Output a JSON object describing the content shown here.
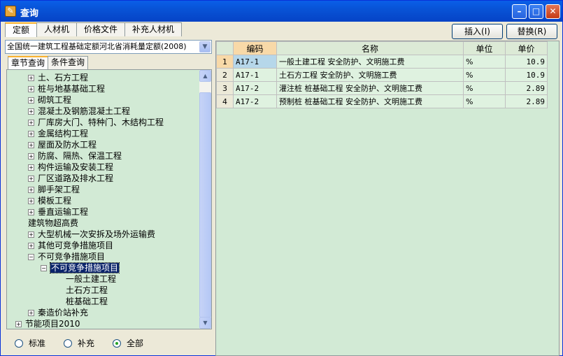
{
  "window": {
    "title": "查询",
    "app_icon": "app-icon"
  },
  "top_tabs": [
    "定额",
    "人材机",
    "价格文件",
    "补充人材机"
  ],
  "buttons": {
    "insert": "插入(I)",
    "replace": "替换(R)"
  },
  "combo": {
    "value": "全国统一建筑工程基础定额河北省消耗量定额(2008)"
  },
  "sub_tabs": [
    "章节查询",
    "条件查询"
  ],
  "tree": [
    {
      "label": "土、石方工程",
      "level": 1,
      "toggle": "+"
    },
    {
      "label": "桩与地基基础工程",
      "level": 1,
      "toggle": "+"
    },
    {
      "label": "砌筑工程",
      "level": 1,
      "toggle": "+"
    },
    {
      "label": "混凝土及钢筋混凝土工程",
      "level": 1,
      "toggle": "+"
    },
    {
      "label": "厂库房大门、特种门、木结构工程",
      "level": 1,
      "toggle": "+"
    },
    {
      "label": "金属结构工程",
      "level": 1,
      "toggle": "+"
    },
    {
      "label": "屋面及防水工程",
      "level": 1,
      "toggle": "+"
    },
    {
      "label": "防腐、隔热、保温工程",
      "level": 1,
      "toggle": "+"
    },
    {
      "label": "构件运输及安装工程",
      "level": 1,
      "toggle": "+"
    },
    {
      "label": "厂区道路及排水工程",
      "level": 1,
      "toggle": "+"
    },
    {
      "label": "脚手架工程",
      "level": 1,
      "toggle": "+"
    },
    {
      "label": "模板工程",
      "level": 1,
      "toggle": "+"
    },
    {
      "label": "垂直运输工程",
      "level": 1,
      "toggle": "+"
    },
    {
      "label": "建筑物超高费",
      "level": 1,
      "toggle": ""
    },
    {
      "label": "大型机械一次安拆及场外运输费",
      "level": 1,
      "toggle": "+"
    },
    {
      "label": "其他可竞争措施项目",
      "level": 1,
      "toggle": "+"
    },
    {
      "label": "不可竞争措施项目",
      "level": 1,
      "toggle": "−"
    },
    {
      "label": "不可竞争措施项目",
      "level": 2,
      "toggle": "−",
      "selected": true
    },
    {
      "label": "一般土建工程",
      "level": 3,
      "toggle": ""
    },
    {
      "label": "土石方工程",
      "level": 3,
      "toggle": ""
    },
    {
      "label": "桩基础工程",
      "level": 3,
      "toggle": ""
    },
    {
      "label": "秦造价站补充",
      "level": 1,
      "toggle": "+"
    },
    {
      "label": "节能项目2010",
      "level": 0,
      "toggle": "+"
    }
  ],
  "radio": {
    "options": [
      "标准",
      "补充",
      "全部"
    ],
    "selected": "全部"
  },
  "grid": {
    "headers": [
      "编码",
      "名称",
      "单位",
      "单价"
    ],
    "rows": [
      {
        "no": "1",
        "code": "A17-1",
        "name": "一般土建工程 安全防护、文明施工费",
        "unit": "%",
        "price": "10.9"
      },
      {
        "no": "2",
        "code": "A17-1",
        "name": "土石方工程 安全防护、文明施工费",
        "unit": "%",
        "price": "10.9"
      },
      {
        "no": "3",
        "code": "A17-2",
        "name": "灌注桩 桩基础工程 安全防护、文明施工费",
        "unit": "%",
        "price": "2.89"
      },
      {
        "no": "4",
        "code": "A17-2",
        "name": "预制桩 桩基础工程 安全防护、文明施工费",
        "unit": "%",
        "price": "2.89"
      }
    ]
  }
}
